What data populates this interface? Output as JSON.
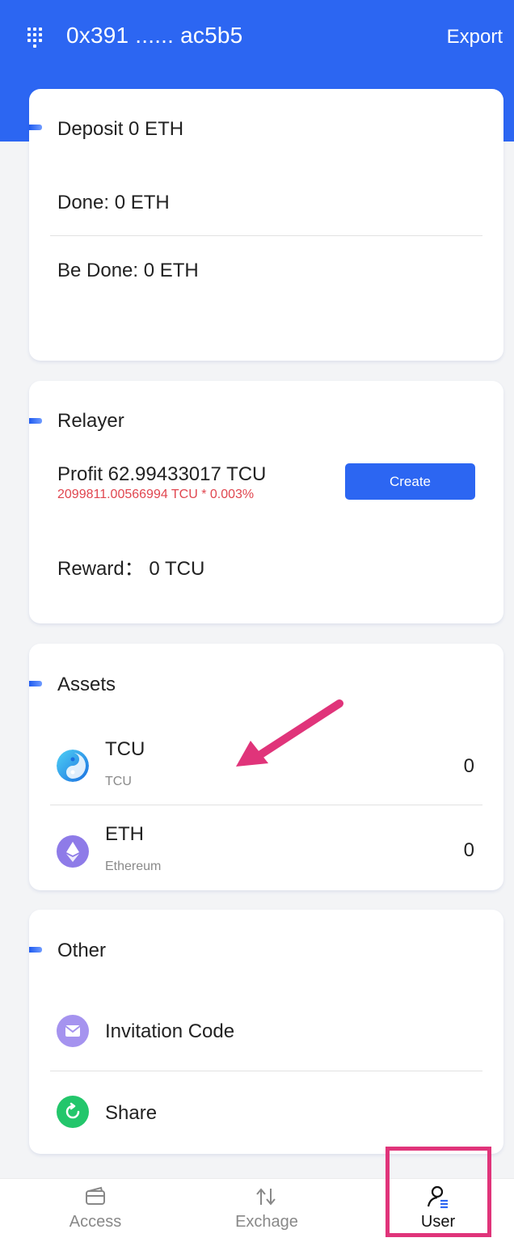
{
  "header": {
    "address": "0x391 ...... ac5b5",
    "export_label": "Export"
  },
  "deposit": {
    "title": "Deposit 0 ETH",
    "done": "Done: 0 ETH",
    "be_done": "Be Done: 0 ETH"
  },
  "relayer": {
    "title": "Relayer",
    "profit": "Profit 62.99433017 TCU",
    "profit_formula": "2099811.00566994 TCU * 0.003%",
    "create_label": "Create",
    "reward": "Reward：  0 TCU"
  },
  "assets": {
    "title": "Assets",
    "items": [
      {
        "name": "TCU",
        "sub": "TCU",
        "value": "0",
        "icon": "tcu-coin-icon"
      },
      {
        "name": "ETH",
        "sub": "Ethereum",
        "value": "0",
        "icon": "eth-coin-icon"
      }
    ]
  },
  "other": {
    "title": "Other",
    "items": [
      {
        "label": "Invitation Code",
        "icon": "envelope-icon"
      },
      {
        "label": "Share",
        "icon": "share-icon"
      }
    ]
  },
  "tabs": [
    {
      "label": "Access",
      "icon": "wallet-icon",
      "active": false
    },
    {
      "label": "Exchage",
      "icon": "swap-arrows-icon",
      "active": false
    },
    {
      "label": "User",
      "icon": "user-icon",
      "active": true
    }
  ],
  "colors": {
    "primary": "#2c66f2",
    "accent_red": "#e0464f",
    "annotation": "#e0347a"
  }
}
